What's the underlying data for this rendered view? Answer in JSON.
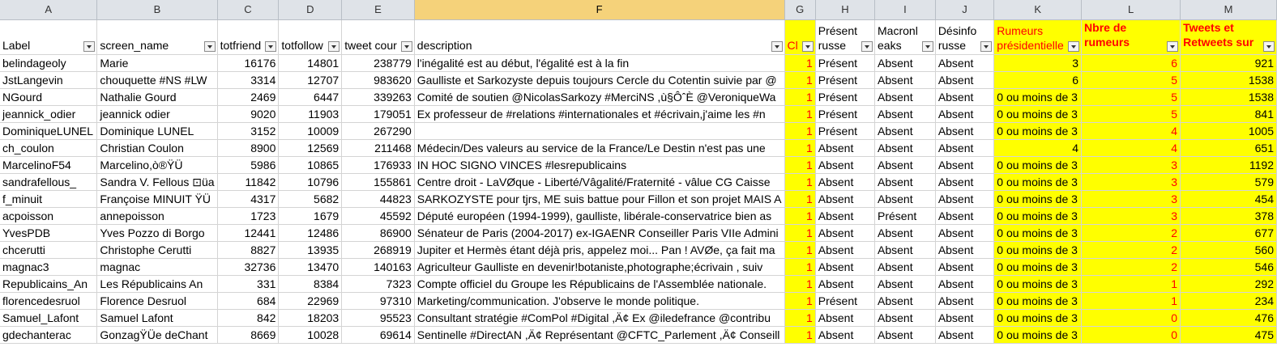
{
  "columns": [
    "A",
    "B",
    "C",
    "D",
    "E",
    "F",
    "G",
    "H",
    "I",
    "J",
    "K",
    "L",
    "M"
  ],
  "headers": {
    "A": "Label",
    "B": "screen_name",
    "C": "totfriend",
    "D": "totfollow",
    "E": "tweet cour",
    "F": "description",
    "G": "Cl",
    "H": "Présent russe",
    "I": "Macronl eaks",
    "J": "Désinfo russe",
    "K": "Rumeurs présidentielle",
    "L": "Nbre de rumeurs Benalla propagées",
    "M": "Tweets et Retweets sur Benalla"
  },
  "colors": {
    "highlight": "#ffff00",
    "red_text": "#ff0000",
    "header_bg": "#dfe3e8",
    "selected_col": "#f5d27a"
  },
  "rows": [
    {
      "A": "belindageoly",
      "B": "Marie",
      "C": "16176",
      "D": "14801",
      "E": "238779",
      "F": "l'inégalité est au début, l'égalité est à la fin",
      "G": "1",
      "H": "Présent",
      "I": "Absent",
      "J": "Absent",
      "K": "3",
      "L": "6",
      "M": "921"
    },
    {
      "A": "JstLangevin",
      "B": "chouquette #NS #LW",
      "C": "3314",
      "D": "12707",
      "E": "983620",
      "F": "Gaulliste et Sarkozyste depuis toujours Cercle du Cotentin suivie par @",
      "G": "1",
      "H": "Présent",
      "I": "Absent",
      "J": "Absent",
      "K": "6",
      "L": "5",
      "M": "1538"
    },
    {
      "A": "NGourd",
      "B": "Nathalie Gourd",
      "C": "2469",
      "D": "6447",
      "E": "339263",
      "F": "Comité de soutien @NicolasSarkozy #MerciNS ,ù§ÔˆÈ @VeroniqueWa",
      "G": "1",
      "H": "Présent",
      "I": "Absent",
      "J": "Absent",
      "K": "0 ou moins de 3",
      "L": "5",
      "M": "1538"
    },
    {
      "A": "jeannick_odier",
      "B": "jeannick odier",
      "C": "9020",
      "D": "11903",
      "E": "179051",
      "F": "Ex professeur de #relations #internationales et #écrivain,j'aime les #n",
      "G": "1",
      "H": "Présent",
      "I": "Absent",
      "J": "Absent",
      "K": "0 ou moins de 3",
      "L": "5",
      "M": "841"
    },
    {
      "A": "DominiqueLUNEL",
      "B": "Dominique LUNEL",
      "C": "3152",
      "D": "10009",
      "E": "267290",
      "F": "",
      "G": "1",
      "H": "Présent",
      "I": "Absent",
      "J": "Absent",
      "K": "0 ou moins de 3",
      "L": "4",
      "M": "1005"
    },
    {
      "A": "ch_coulon",
      "B": "Christian Coulon",
      "C": "8900",
      "D": "12569",
      "E": "211468",
      "F": "Médecin/Des valeurs au service de la France/Le Destin n'est pas une",
      "G": "1",
      "H": "Absent",
      "I": "Absent",
      "J": "Absent",
      "K": "4",
      "L": "4",
      "M": "651"
    },
    {
      "A": "MarcelinoF54",
      "B": "Marcelino,ò®ŸÜ",
      "C": "5986",
      "D": "10865",
      "E": "176933",
      "F": "IN HOC SIGNO VINCES #lesrepublicains",
      "G": "1",
      "H": "Absent",
      "I": "Absent",
      "J": "Absent",
      "K": "0 ou moins de 3",
      "L": "3",
      "M": "1192"
    },
    {
      "A": "sandrafellous_",
      "B": "Sandra V. Fellous ⊡üa",
      "C": "11842",
      "D": "10796",
      "E": "155861",
      "F": "Centre droit - LaVØque - Liberté/Vâgalité/Fraternité - vâlue CG Caisse",
      "G": "1",
      "H": "Absent",
      "I": "Absent",
      "J": "Absent",
      "K": "0 ou moins de 3",
      "L": "3",
      "M": "579"
    },
    {
      "A": "f_minuit",
      "B": "Françoise MINUIT ŸÜ",
      "C": "4317",
      "D": "5682",
      "E": "44823",
      "F": "SARKOZYSTE pour tjrs, ME suis battue pour Fillon et son projet MAIS A",
      "G": "1",
      "H": "Absent",
      "I": "Absent",
      "J": "Absent",
      "K": "0 ou moins de 3",
      "L": "3",
      "M": "454"
    },
    {
      "A": "acpoisson",
      "B": "annepoisson",
      "C": "1723",
      "D": "1679",
      "E": "45592",
      "F": "Député européen (1994-1999), gaulliste, libérale-conservatrice bien as",
      "G": "1",
      "H": "Absent",
      "I": "Présent",
      "J": "Absent",
      "K": "0 ou moins de 3",
      "L": "3",
      "M": "378"
    },
    {
      "A": "YvesPDB",
      "B": "Yves Pozzo di Borgo",
      "C": "12441",
      "D": "12486",
      "E": "86900",
      "F": "Sénateur de Paris (2004-2017) ex-IGAENR Conseiller Paris VIIe Admini",
      "G": "1",
      "H": "Absent",
      "I": "Absent",
      "J": "Absent",
      "K": "0 ou moins de 3",
      "L": "2",
      "M": "677"
    },
    {
      "A": "chcerutti",
      "B": "Christophe Cerutti",
      "C": "8827",
      "D": "13935",
      "E": "268919",
      "F": "Jupiter et Hermès étant déjà pris, appelez moi... Pan ! AVØe, ça fait ma",
      "G": "1",
      "H": "Absent",
      "I": "Absent",
      "J": "Absent",
      "K": "0 ou moins de 3",
      "L": "2",
      "M": "560"
    },
    {
      "A": "magnac3",
      "B": "magnac",
      "C": "32736",
      "D": "13470",
      "E": "140163",
      "F": "Agriculteur Gaulliste en devenir!botaniste,photographe;écrivain , suiv",
      "G": "1",
      "H": "Absent",
      "I": "Absent",
      "J": "Absent",
      "K": "0 ou moins de 3",
      "L": "2",
      "M": "546"
    },
    {
      "A": "Republicains_An",
      "B": "Les Républicains An",
      "C": "331",
      "D": "8384",
      "E": "7323",
      "F": "Compte officiel du Groupe les Républicains de l'Assemblée nationale.",
      "G": "1",
      "H": "Absent",
      "I": "Absent",
      "J": "Absent",
      "K": "0 ou moins de 3",
      "L": "1",
      "M": "292"
    },
    {
      "A": "florencedesruol",
      "B": "Florence Desruol",
      "C": "684",
      "D": "22969",
      "E": "97310",
      "F": "Marketing/communication. J'observe le monde politique.",
      "G": "1",
      "H": "Présent",
      "I": "Absent",
      "J": "Absent",
      "K": "0 ou moins de 3",
      "L": "1",
      "M": "234"
    },
    {
      "A": "Samuel_Lafont",
      "B": "Samuel Lafont",
      "C": "842",
      "D": "18203",
      "E": "95523",
      "F": "Consultant stratégie #ComPol #Digital ,Ä¢ Ex @iledefrance @contribu",
      "G": "1",
      "H": "Absent",
      "I": "Absent",
      "J": "Absent",
      "K": "0 ou moins de 3",
      "L": "0",
      "M": "476"
    },
    {
      "A": "gdechanterac",
      "B": "GonzagŸÜe deChant",
      "C": "8669",
      "D": "10028",
      "E": "69614",
      "F": "Sentinelle #DirectAN ,Ä¢ Représentant @CFTC_Parlement ,Ä¢ Conseill",
      "G": "1",
      "H": "Absent",
      "I": "Absent",
      "J": "Absent",
      "K": "0 ou moins de 3",
      "L": "0",
      "M": "475"
    }
  ]
}
